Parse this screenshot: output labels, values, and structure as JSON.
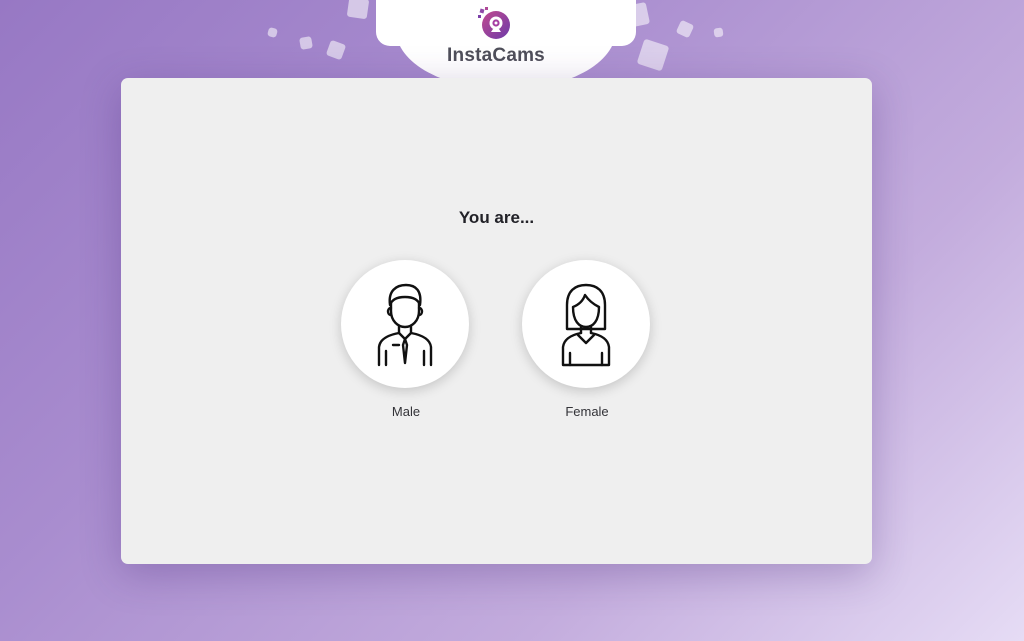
{
  "brand": {
    "name": "InstaCams",
    "logo_icon": "webcam-icon",
    "accent_color": "#a63fa3"
  },
  "page": {
    "background_colors": [
      "#9778c4",
      "#e6dcf5"
    ]
  },
  "signup": {
    "question": "You are...",
    "options": [
      {
        "label": "Male",
        "icon": "man-avatar-icon"
      },
      {
        "label": "Female",
        "icon": "woman-avatar-icon"
      }
    ]
  }
}
